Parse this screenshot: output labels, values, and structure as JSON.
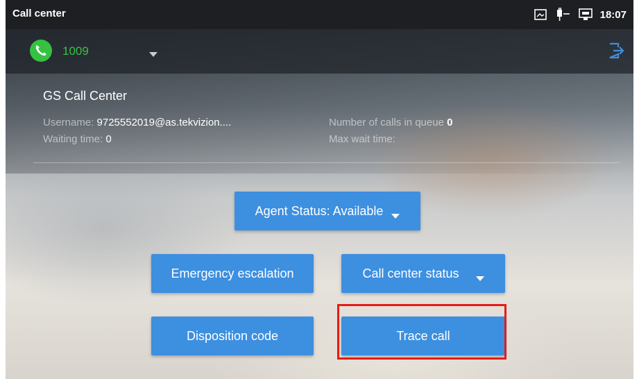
{
  "statusbar": {
    "title": "Call center",
    "time": "18:07",
    "icons": [
      "screenshot-icon",
      "usb-power-icon",
      "ethernet-icon"
    ]
  },
  "account": {
    "number": "1009",
    "status_color": "#35c241",
    "icons": [
      "phone-icon",
      "chevron-down-icon",
      "logout-icon"
    ]
  },
  "call_center": {
    "name": "GS Call Center",
    "username_label": "Username:",
    "username_value": "9725552019@as.tekvizion....",
    "waiting_label": "Waiting time:",
    "waiting_value": "0",
    "queue_label": "Number of calls in queue",
    "queue_value": "0",
    "max_wait_label": "Max wait time:",
    "max_wait_value": ""
  },
  "buttons": {
    "agent_status": "Agent Status: Available",
    "emergency": "Emergency escalation",
    "cc_status": "Call center status",
    "disposition": "Disposition code",
    "trace": "Trace call"
  },
  "colors": {
    "button_bg": "#3d8fe0",
    "highlight": "#e41b17"
  }
}
